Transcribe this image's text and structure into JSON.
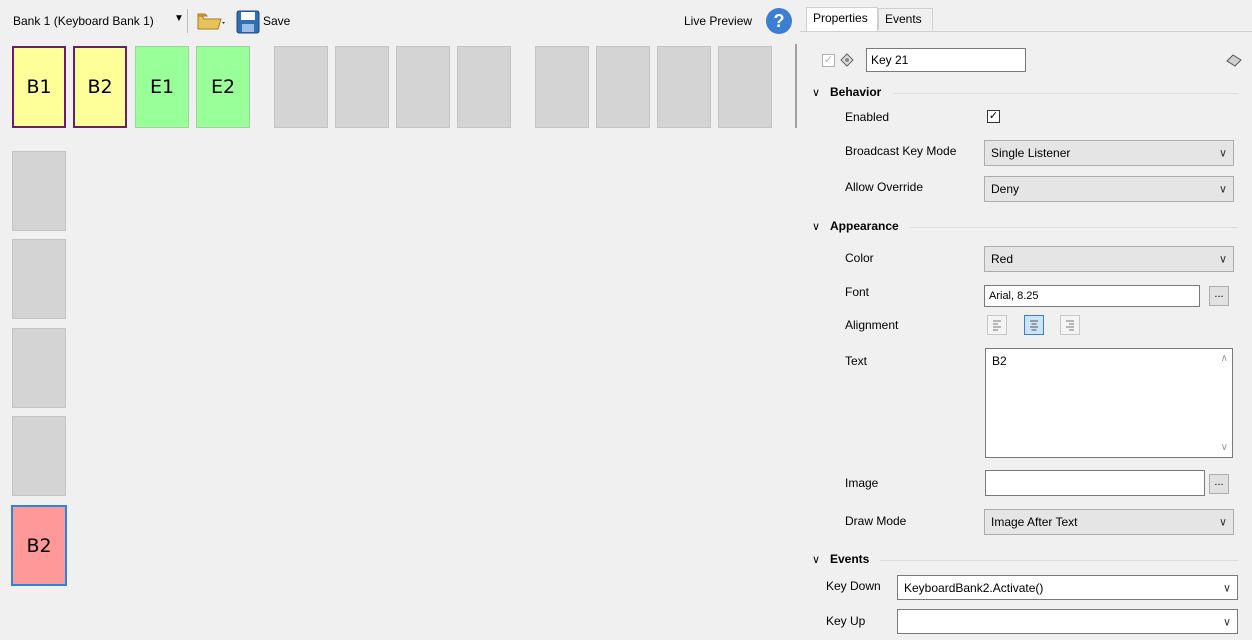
{
  "toolbar": {
    "bank_select": "Bank 1 (Keyboard Bank 1)",
    "save_label": "Save",
    "live_preview_label": "Live Preview",
    "help_glyph": "?"
  },
  "keys": {
    "row1": [
      {
        "label": "B1",
        "color": "yellow"
      },
      {
        "label": "B2",
        "color": "yellow"
      },
      {
        "label": "E1",
        "color": "green"
      },
      {
        "label": "E2",
        "color": "green"
      }
    ],
    "column": [
      {
        "label": "B2",
        "color": "red"
      }
    ]
  },
  "colors": {
    "yellow": "#ffff99",
    "green": "#99ff99",
    "red": "#ff9999",
    "empty": "#d4d4d4",
    "selection_border": "#2e85d6"
  },
  "tabs": [
    {
      "label": "Properties"
    },
    {
      "label": "Events"
    }
  ],
  "properties": {
    "key_name": "Key 21",
    "behavior": {
      "title": "Behavior",
      "enabled_label": "Enabled",
      "enabled_checked": true,
      "broadcast_label": "Broadcast Key Mode",
      "broadcast_value": "Single Listener",
      "override_label": "Allow Override",
      "override_value": "Deny"
    },
    "appearance": {
      "title": "Appearance",
      "color_label": "Color",
      "color_value": "Red",
      "font_label": "Font",
      "font_value": "Arial, 8.25",
      "alignment_label": "Alignment",
      "alignment_selected": "center",
      "text_label": "Text",
      "text_value": "B2",
      "image_label": "Image",
      "image_value": "",
      "drawmode_label": "Draw Mode",
      "drawmode_value": "Image After Text"
    },
    "events": {
      "title": "Events",
      "keydown_label": "Key Down",
      "keydown_value": "KeyboardBank2.Activate()",
      "keyup_label": "Key Up",
      "keyup_value": ""
    },
    "ellipsis": "..."
  }
}
